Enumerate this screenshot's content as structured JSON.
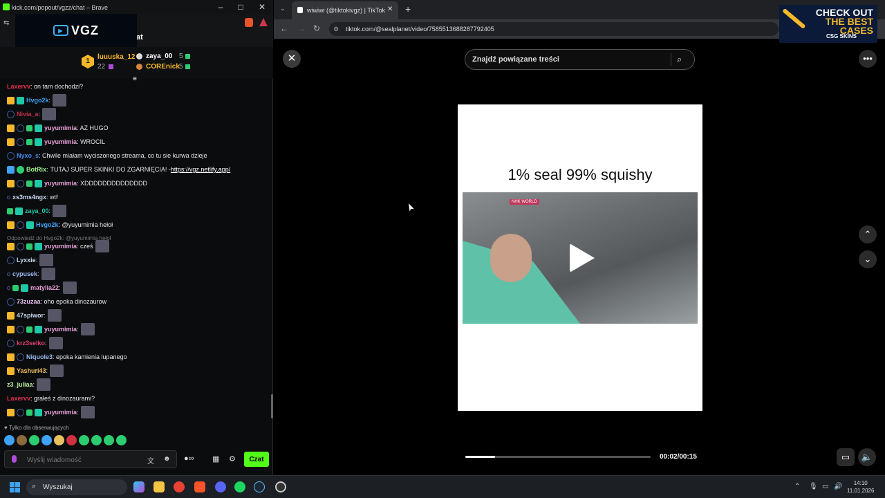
{
  "left_window": {
    "title": "kick.com/popout/vgzz/chat – Brave",
    "brand": "VGZ",
    "chat_tab_fragment": "at"
  },
  "leaderboard": {
    "rank_badge": "1",
    "first": {
      "name": "luuuska_12",
      "count": "22"
    },
    "second": {
      "name": "zaya_00",
      "count": "5"
    },
    "third": {
      "name": "COREnick",
      "count": "5"
    }
  },
  "chat": [
    {
      "user": "Laxervv",
      "text": ": on tam dochodzi?",
      "color": "#e0304a"
    },
    {
      "user": "Hvgo2k",
      "text": ":",
      "color": "#3fa2f5"
    },
    {
      "user": "Nivia_a",
      "text": ":",
      "color": "#c0304a"
    },
    {
      "user": "yuyumimia",
      "text": ": AZ HUGO",
      "color": "#e8a0d8"
    },
    {
      "user": "yuyumimia",
      "text": ": WROCIL",
      "color": "#e8a0d8"
    },
    {
      "user": "Nyxo_s",
      "text": ": Chwile miałam wyciszonego streama, co tu sie kurwa dzieje",
      "color": "#4a8cf0"
    },
    {
      "user": "BotRix",
      "text": ": ",
      "color": "#9df58a",
      "extra": "TUTAJ SUPER SKINKI DO ZGARNIĘCIA! - ",
      "link": "https://vgz.netlify.app/"
    },
    {
      "user": "yuyumimia",
      "text": ": XDDDDDDDDDDDDDD",
      "color": "#e8a0d8"
    },
    {
      "user": "xs3ms4ngx",
      "text": ": wtf",
      "color": "#c8d8f0"
    },
    {
      "user": "zaya_00",
      "text": ":",
      "color": "#1ec8a8"
    },
    {
      "user": "Hvgo2k",
      "text": ": @yuyumimia hełoł",
      "color": "#3fa2f5"
    },
    {
      "user": "yuyumimia",
      "text": ": cześ",
      "color": "#e8a0d8"
    },
    {
      "user": "Lyxxie",
      "text": ":",
      "color": "#c8d8f0"
    },
    {
      "user": "cypusek",
      "text": ":",
      "color": "#9bb8f0"
    },
    {
      "user": "matylia22",
      "text": ":",
      "color": "#e8a0d8"
    },
    {
      "user": "73zuzaa",
      "text": ": oho epoka dinozaurow",
      "color": "#e8c0f0"
    },
    {
      "user": "47spiwor",
      "text": ":",
      "color": "#c8d8f0"
    },
    {
      "user": "yuyumimia",
      "text": ":",
      "color": "#e8a0d8"
    },
    {
      "user": "krz3selko",
      "text": ":",
      "color": "#e04070"
    },
    {
      "user": "Niquole3",
      "text": ": epoka kamienia lupanego",
      "color": "#9bb8f0"
    },
    {
      "user": "Yashuri43",
      "text": ":",
      "color": "#f0c060"
    },
    {
      "user": "z3_juliaa",
      "text": ":",
      "color": "#b8f0a0"
    },
    {
      "user": "Laxervv",
      "text": ": grałeś z dinozaurami?",
      "color": "#e0304a"
    },
    {
      "user": "yuyumimia",
      "text": ":",
      "color": "#e8a0d8"
    }
  ],
  "reply_note": "Odpowiedź do Hvgo2k: @yuyumimia hełoł",
  "followers_only": "Tylko dla obserwujących",
  "input": {
    "placeholder": "Wyślij wiadomość",
    "send_label": "Czat"
  },
  "browser": {
    "tab_title": "wiwiwi (@tiktokivgz) | TikTok",
    "url": "tiktok.com/@sealplanet/video/7585513688287792405"
  },
  "ad": {
    "line1": "CHECK OUT",
    "line2": "THE BEST",
    "line3": "CASES",
    "brand": "CSG SKINS"
  },
  "tiktok": {
    "search_text": "Znajdź powiązane treści",
    "caption": "1% seal 99% squishy",
    "watermark": "NHK WORLD",
    "time": "00:02/00:15",
    "progress": 0.16
  },
  "taskbar": {
    "search": "Wyszukaj",
    "time": "14:10",
    "date": "11.01.2026"
  },
  "colors": {
    "kick_green": "#53fc18",
    "accent_blue": "#3fa2f5"
  }
}
